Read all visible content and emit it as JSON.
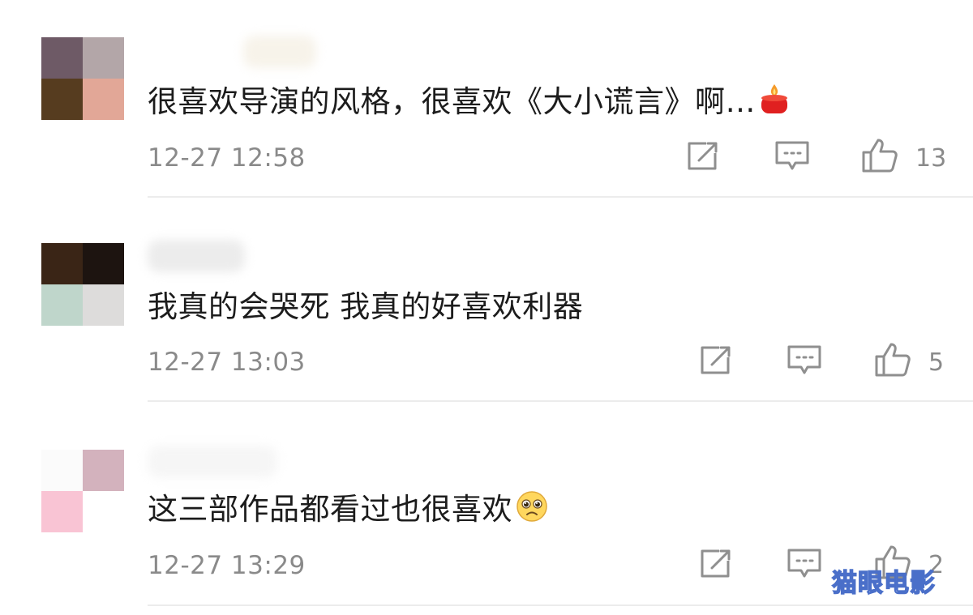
{
  "comments": [
    {
      "text": "很喜欢导演的风格，很喜欢《大小谎言》啊…",
      "emoji": "candle-emoji",
      "time": "12-27 12:58",
      "likes": "13",
      "avatar_colors": [
        "#6e5a66",
        "#b3a6a8",
        "#563c1f",
        "#e2a797"
      ]
    },
    {
      "text": "我真的会哭死 我真的好喜欢利器",
      "emoji": "",
      "time": "12-27 13:03",
      "likes": "5",
      "avatar_colors": [
        "#3a2516",
        "#1d1410",
        "#bfd6cb",
        "#dddcdb"
      ]
    },
    {
      "text": "这三部作品都看过也很喜欢",
      "emoji": "pleading-face-emoji",
      "time": "12-27 13:29",
      "likes": "2",
      "avatar_colors": [
        "#fbfbfb",
        "#d3b2bd",
        "#f9c4d4",
        "#ffffff"
      ]
    }
  ],
  "icons": {
    "share": "share-icon",
    "reply": "comment-icon",
    "like": "thumbs-up-icon"
  },
  "colors": {
    "text": "#1c1c1c",
    "meta": "#8a8a8a",
    "icon": "#8f8f8f",
    "watermark_outline": "#4a6fc9"
  },
  "watermark": "猫眼电影"
}
